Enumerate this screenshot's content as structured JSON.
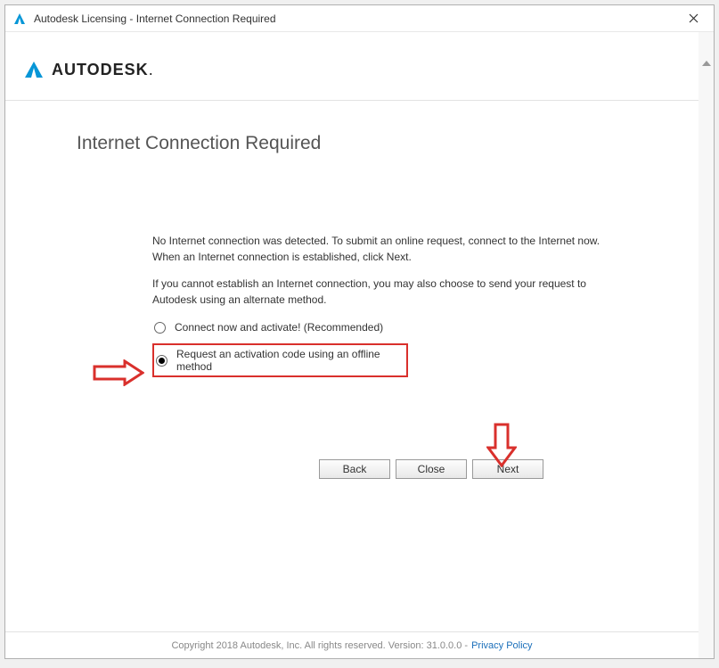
{
  "window": {
    "title": "Autodesk Licensing - Internet Connection Required"
  },
  "brand": {
    "name": "AUTODESK"
  },
  "page": {
    "title": "Internet Connection Required",
    "para1": "No Internet connection was detected. To submit an online request, connect to the Internet now. When an Internet connection is established, click Next.",
    "para2": "If you cannot establish an Internet connection, you may also choose to send your request to Autodesk using an alternate method."
  },
  "options": {
    "opt1": "Connect now and activate! (Recommended)",
    "opt2": "Request an activation code using an offline method"
  },
  "buttons": {
    "back": "Back",
    "close": "Close",
    "next": "Next"
  },
  "footer": {
    "copyright": "Copyright 2018 Autodesk, Inc. All rights reserved. Version: 31.0.0.0 -",
    "privacy": "Privacy Policy"
  }
}
